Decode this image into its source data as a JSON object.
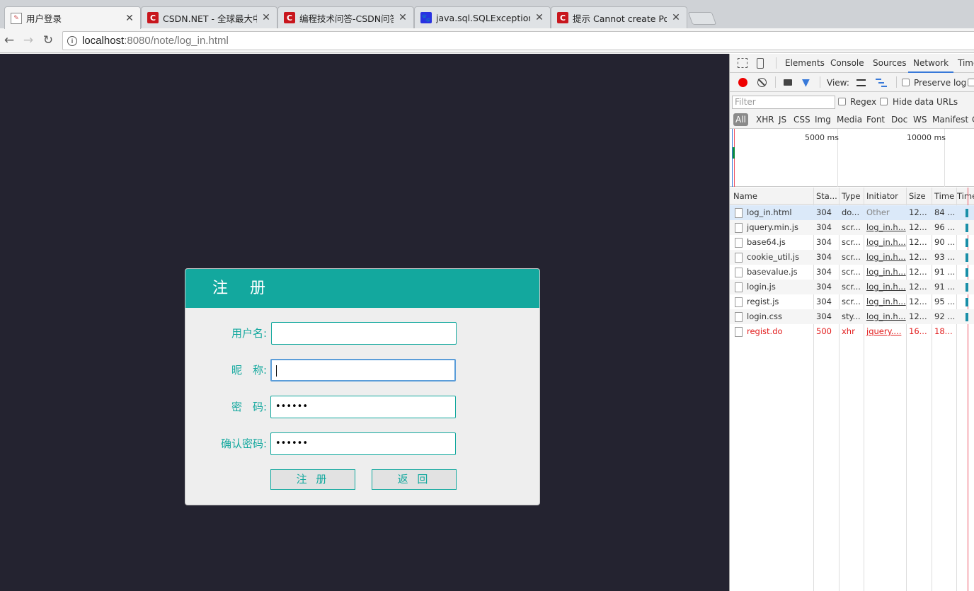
{
  "browser": {
    "tabs": [
      {
        "title": "用户登录",
        "icon": "page-icon",
        "active": true
      },
      {
        "title": "CSDN.NET - 全球最大中",
        "icon": "csdn-icon",
        "active": false
      },
      {
        "title": "编程技术问答-CSDN问答",
        "icon": "csdn-icon",
        "active": false
      },
      {
        "title": "java.sql.SQLException_",
        "icon": "baidu-icon",
        "active": false
      },
      {
        "title": "提示 Cannot create Poo",
        "icon": "csdn-icon",
        "active": false
      }
    ],
    "url_host": "localhost",
    "url_rest": ":8080/note/log_in.html"
  },
  "register": {
    "title": "注 册",
    "fields": [
      {
        "label": "用户名:",
        "value": ""
      },
      {
        "label": "昵　称:",
        "value": ""
      },
      {
        "label": "密　码:",
        "value": "••••••"
      },
      {
        "label": "确认密码:",
        "value": "••••••"
      }
    ],
    "submit_label": "注 册",
    "back_label": "返 回"
  },
  "devtools": {
    "tabs": [
      "Elements",
      "Console",
      "Sources",
      "Network",
      "Time"
    ],
    "selected_tab": "Network",
    "view_label": "View:",
    "preserve_log": "Preserve log",
    "filter_placeholder": "Filter",
    "regex": "Regex",
    "hide_data_urls": "Hide data URLs",
    "types": [
      "All",
      "XHR",
      "JS",
      "CSS",
      "Img",
      "Media",
      "Font",
      "Doc",
      "WS",
      "Manifest",
      "C"
    ],
    "overview_labels": [
      "5000 ms",
      "10000 ms"
    ],
    "columns": [
      "Name",
      "Sta...",
      "Type",
      "Initiator",
      "Size",
      "Time",
      "Time"
    ],
    "requests": [
      {
        "name": "log_in.html",
        "status": "304",
        "type": "do...",
        "initiator": "Other",
        "size": "12...",
        "time": "84 ..."
      },
      {
        "name": "jquery.min.js",
        "status": "304",
        "type": "scr...",
        "initiator": "log_in.h...",
        "size": "12...",
        "time": "96 ..."
      },
      {
        "name": "base64.js",
        "status": "304",
        "type": "scr...",
        "initiator": "log_in.h...",
        "size": "12...",
        "time": "90 ..."
      },
      {
        "name": "cookie_util.js",
        "status": "304",
        "type": "scr...",
        "initiator": "log_in.h...",
        "size": "12...",
        "time": "93 ..."
      },
      {
        "name": "basevalue.js",
        "status": "304",
        "type": "scr...",
        "initiator": "log_in.h...",
        "size": "12...",
        "time": "91 ..."
      },
      {
        "name": "login.js",
        "status": "304",
        "type": "scr...",
        "initiator": "log_in.h...",
        "size": "12...",
        "time": "91 ..."
      },
      {
        "name": "regist.js",
        "status": "304",
        "type": "scr...",
        "initiator": "log_in.h...",
        "size": "12...",
        "time": "95 ..."
      },
      {
        "name": "login.css",
        "status": "304",
        "type": "sty...",
        "initiator": "log_in.h...",
        "size": "12...",
        "time": "92 ..."
      },
      {
        "name": "regist.do",
        "status": "500",
        "type": "xhr",
        "initiator": "jquery....",
        "size": "16...",
        "time": "18..."
      }
    ]
  },
  "colors": {
    "accent": "#13a89e",
    "page_bg": "#242330",
    "error": "#e21b1b",
    "devtools_selected": "#3879d9"
  }
}
